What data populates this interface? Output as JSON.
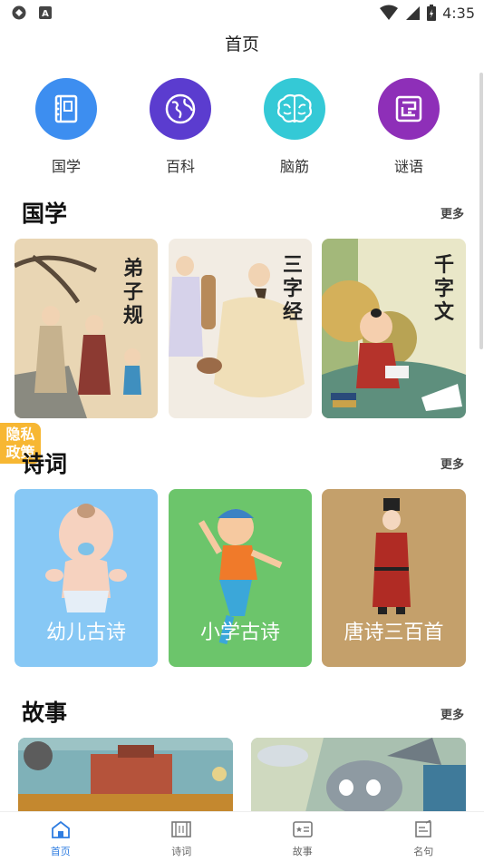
{
  "status": {
    "time": "4:35"
  },
  "header": {
    "title": "首页"
  },
  "categories": [
    {
      "label": "国学",
      "color": "#3d8ef0",
      "icon": "book-icon"
    },
    {
      "label": "百科",
      "color": "#5b3ccf",
      "icon": "globe-icon"
    },
    {
      "label": "脑筋",
      "color": "#34c9d6",
      "icon": "brain-icon"
    },
    {
      "label": "谜语",
      "color": "#8e2fb8",
      "icon": "maze-icon"
    }
  ],
  "sections": {
    "guoxue": {
      "title": "国学",
      "more": "更多",
      "cards": [
        {
          "title": "弟子规"
        },
        {
          "title": "三字经"
        },
        {
          "title": "千字文"
        }
      ]
    },
    "shici": {
      "title": "诗词",
      "more": "更多",
      "cards": [
        {
          "title": "幼儿古诗",
          "color": "#87c8f5"
        },
        {
          "title": "小学古诗",
          "color": "#6cc56b"
        },
        {
          "title": "唐诗三百首",
          "color": "#c4a06b"
        }
      ]
    },
    "gushi": {
      "title": "故事",
      "more": "更多"
    }
  },
  "privacy": {
    "label": "隐私政策"
  },
  "nav": [
    {
      "label": "首页",
      "icon": "home-icon",
      "active": true
    },
    {
      "label": "诗词",
      "icon": "scroll-icon",
      "active": false
    },
    {
      "label": "故事",
      "icon": "story-icon",
      "active": false
    },
    {
      "label": "名句",
      "icon": "note-icon",
      "active": false
    }
  ]
}
